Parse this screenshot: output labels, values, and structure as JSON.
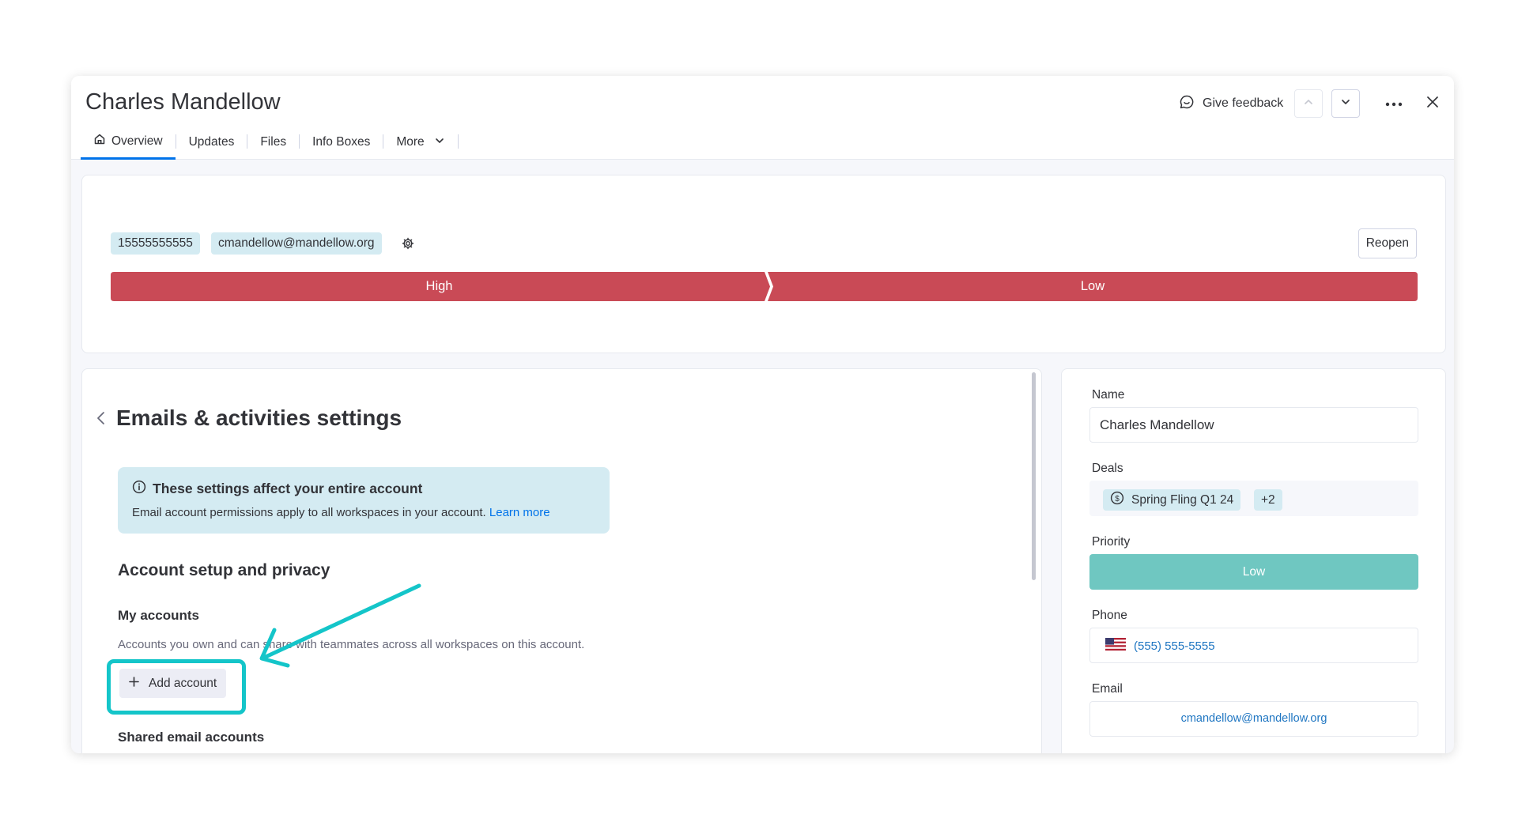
{
  "window": {
    "title": "Charles Mandellow",
    "feedback_label": "Give feedback"
  },
  "tabs": [
    {
      "label": "Overview",
      "active": true,
      "icon": "home-icon"
    },
    {
      "label": "Updates"
    },
    {
      "label": "Files"
    },
    {
      "label": "Info Boxes"
    },
    {
      "label": "More",
      "icon": "chevron-down-icon"
    }
  ],
  "summary": {
    "phone_chip": "15555555555",
    "email_chip": "cmandellow@mandellow.org",
    "reopen_label": "Reopen",
    "stages": [
      {
        "label": "High",
        "color": "#c94a56"
      },
      {
        "label": "Low",
        "color": "#c94a56"
      }
    ]
  },
  "settings": {
    "back_icon": "chevron-left-icon",
    "title": "Emails & activities settings",
    "info_title": "These settings affect your entire account",
    "info_body": "Email account permissions apply to all workspaces in your account.",
    "info_link": "Learn more",
    "section_title": "Account setup and privacy",
    "my_accounts_title": "My accounts",
    "my_accounts_desc": "Accounts you own and can share with teammates across all workspaces on this account.",
    "add_account_label": "Add account",
    "shared_title": "Shared email accounts"
  },
  "details": {
    "name_label": "Name",
    "name_value": "Charles Mandellow",
    "deals_label": "Deals",
    "deal_value": "Spring Fling Q1 24",
    "deal_more": "+2",
    "priority_label": "Priority",
    "priority_value": "Low",
    "phone_label": "Phone",
    "phone_value": "(555) 555-5555",
    "email_label": "Email",
    "email_value": "cmandellow@mandellow.org"
  },
  "colors": {
    "accent": "#0073ea",
    "stage_red": "#c94a56",
    "priority_teal": "#6fc7c1",
    "chip_blue": "#d4ebf2",
    "annotation_teal": "#14c5c9",
    "link": "#1f76c2"
  }
}
